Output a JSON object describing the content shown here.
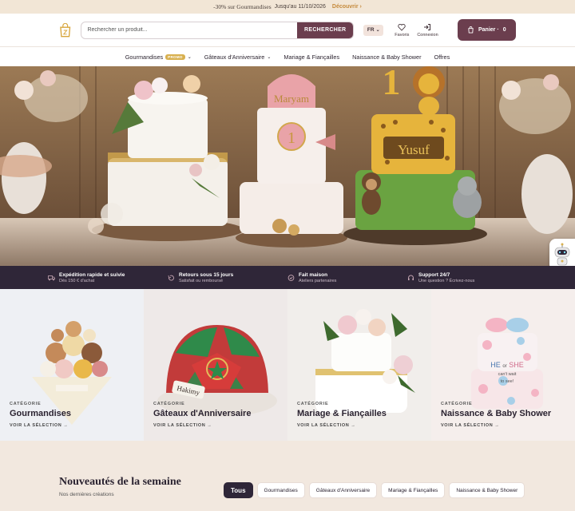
{
  "promo": {
    "highlight": "-30% sur Gourmandises",
    "until": "Jusqu'au 11/10/2026",
    "link": "Découvrir",
    "arrow": "›"
  },
  "header": {
    "search_placeholder": "Rechercher un produit...",
    "search_button": "RECHERCHER",
    "lang": "FR",
    "favorites": "Favoris",
    "login": "Connexion",
    "cart_label": "Panier ·",
    "cart_count": "0"
  },
  "nav": {
    "items": [
      {
        "label": "Gourmandises",
        "badge": "PROMO",
        "chevron": true
      },
      {
        "label": "Gâteaux d'Anniversaire",
        "chevron": true
      },
      {
        "label": "Mariage & Fiançailles"
      },
      {
        "label": "Naissance & Baby Shower"
      },
      {
        "label": "Offres"
      }
    ]
  },
  "hero": {
    "cake1_name": "Maryam",
    "cake1_number": "1",
    "cake2_name": "Yusuf",
    "cake2_number": "1"
  },
  "features": [
    {
      "title": "Expédition rapide et suivie",
      "subtitle": "Dès 150 € d'achat"
    },
    {
      "title": "Retours sous 15 jours",
      "subtitle": "Satisfait ou remboursé"
    },
    {
      "title": "Fait maison",
      "subtitle": "Ateliers partenaires"
    },
    {
      "title": "Support 24/7",
      "subtitle": "Une question ? Écrivez-nous"
    }
  ],
  "categories": [
    {
      "label": "CATÉGORIE",
      "name": "Gourmandises",
      "cta": "VOIR LA SÉLECTION →"
    },
    {
      "label": "CATÉGORIE",
      "name": "Gâteaux d'Anniversaire",
      "cta": "VOIR LA SÉLECTION →"
    },
    {
      "label": "CATÉGORIE",
      "name": "Mariage & Fiançailles",
      "cta": "VOIR LA SÉLECTION →"
    },
    {
      "label": "CATÉGORIE",
      "name": "Naissance & Baby Shower",
      "cta": "VOIR LA SÉLECTION →"
    }
  ],
  "cat_art": {
    "hakimy": "Hakimy",
    "he": "HE",
    "or": "or",
    "she": "SHE",
    "cant": "can't wait",
    "tosee": "to see!"
  },
  "news": {
    "title": "Nouveautés de la semaine",
    "subtitle": "Nos dernières créations",
    "tabs": [
      "Tous",
      "Gourmandises",
      "Gâteaux d'Anniversaire",
      "Mariage & Fiançailles",
      "Naissance & Baby Shower"
    ]
  },
  "colors": {
    "primary": "#6b3e4e",
    "dark": "#2f2638",
    "gold": "#d8b04f"
  }
}
